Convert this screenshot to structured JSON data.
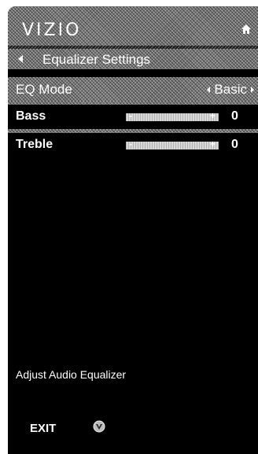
{
  "brand": {
    "logo": "VIZIO"
  },
  "nav": {
    "title": "Equalizer Settings"
  },
  "eq_mode": {
    "label": "EQ Mode",
    "value": "Basic"
  },
  "sliders": [
    {
      "label": "Bass",
      "value": "0",
      "minus": "-",
      "plus": "+"
    },
    {
      "label": "Treble",
      "value": "0",
      "minus": "-",
      "plus": "+"
    }
  ],
  "help": {
    "text": "Adjust Audio Equalizer"
  },
  "footer": {
    "exit_label": "EXIT"
  },
  "icons": {
    "home": "home-icon",
    "back": "back-arrow-icon",
    "left": "left-arrow-icon",
    "right": "right-arrow-icon",
    "vizio_v": "vizio-v-icon"
  }
}
